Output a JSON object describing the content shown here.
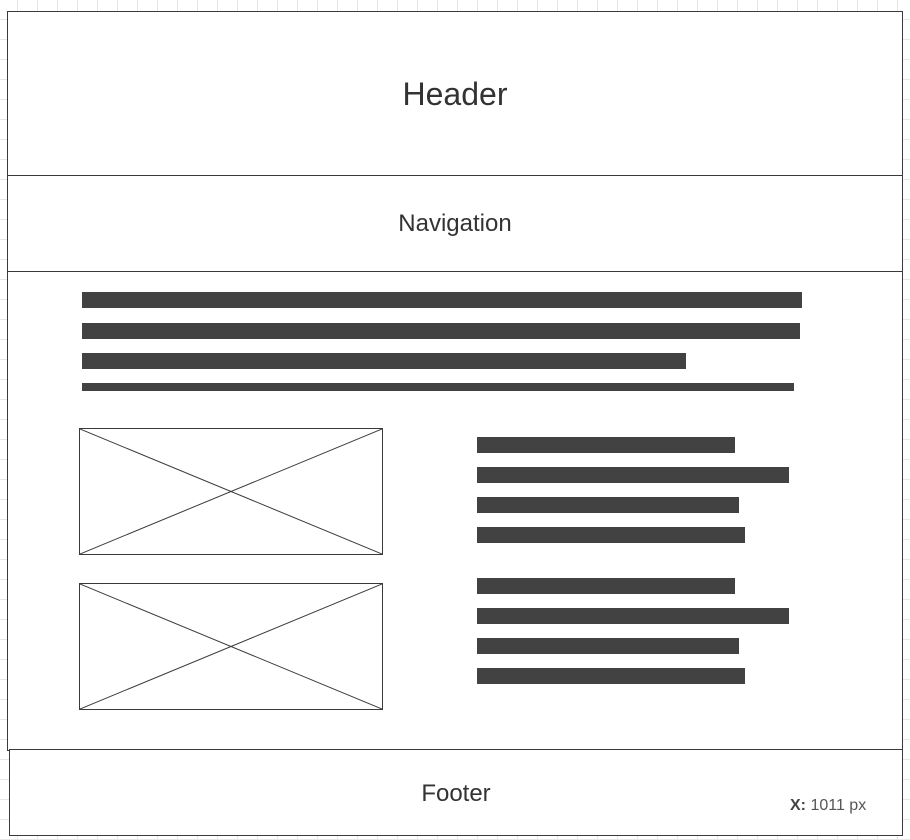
{
  "wireframe": {
    "header": {
      "label": "Header"
    },
    "navigation": {
      "label": "Navigation"
    },
    "footer": {
      "label": "Footer"
    }
  },
  "status": {
    "x_label": "X:",
    "x_value": "1011 px"
  },
  "colors": {
    "stroke": "#3a3a3a",
    "text_bar": "#424242",
    "grid": "#e6e6e6"
  },
  "icons": {
    "image_placeholder": "image-placeholder-icon"
  }
}
